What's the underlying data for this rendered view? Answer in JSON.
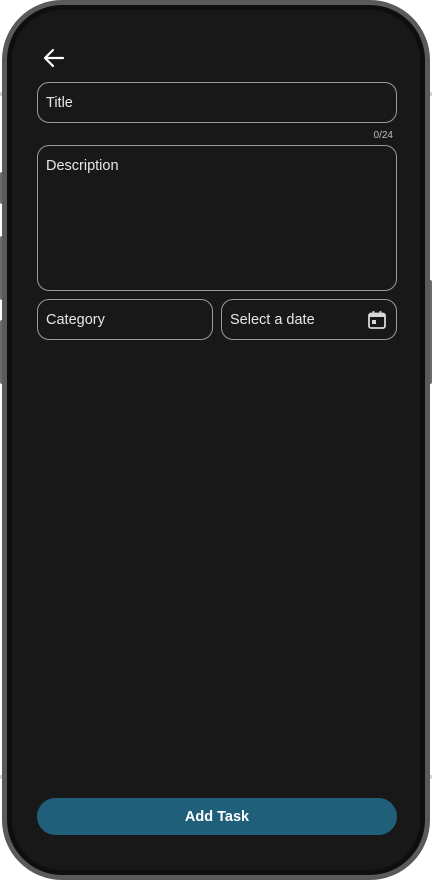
{
  "navigation": {
    "back_icon": "arrow-left-icon"
  },
  "form": {
    "title": {
      "label": "Title",
      "counter": "0/24"
    },
    "description": {
      "label": "Description"
    },
    "category": {
      "label": "Category"
    },
    "date": {
      "label": "Select a date",
      "icon": "calendar-icon"
    }
  },
  "actions": {
    "add_task_label": "Add Task"
  },
  "colors": {
    "background": "#181818",
    "field_border": "#9a9a9a",
    "text": "#e6e6e6",
    "accent": "#1f5f7a"
  }
}
